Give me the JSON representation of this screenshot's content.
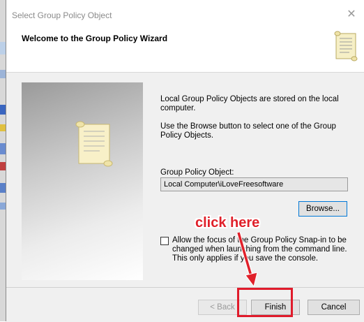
{
  "window": {
    "title": "Select Group Policy Object",
    "close_glyph": "✕"
  },
  "header": {
    "title": "Welcome to the Group Policy Wizard",
    "icon": "scroll-icon"
  },
  "body": {
    "description_1": "Local Group Policy Objects are stored on the local computer.",
    "description_2": "Use the Browse button to select one of the Group Policy Objects.",
    "gpo_label": "Group Policy Object:",
    "gpo_value": "Local Computer\\iLoveFreesoftware",
    "browse_label": "Browse...",
    "checkbox_checked": false,
    "checkbox_label": "Allow the focus of the Group Policy Snap-in to be changed when launching from the command line.  This only applies if you save the console."
  },
  "footer": {
    "back_label": "< Back",
    "finish_label": "Finish",
    "cancel_label": "Cancel"
  },
  "annotation": {
    "text": "click here",
    "color": "#e0202a"
  }
}
